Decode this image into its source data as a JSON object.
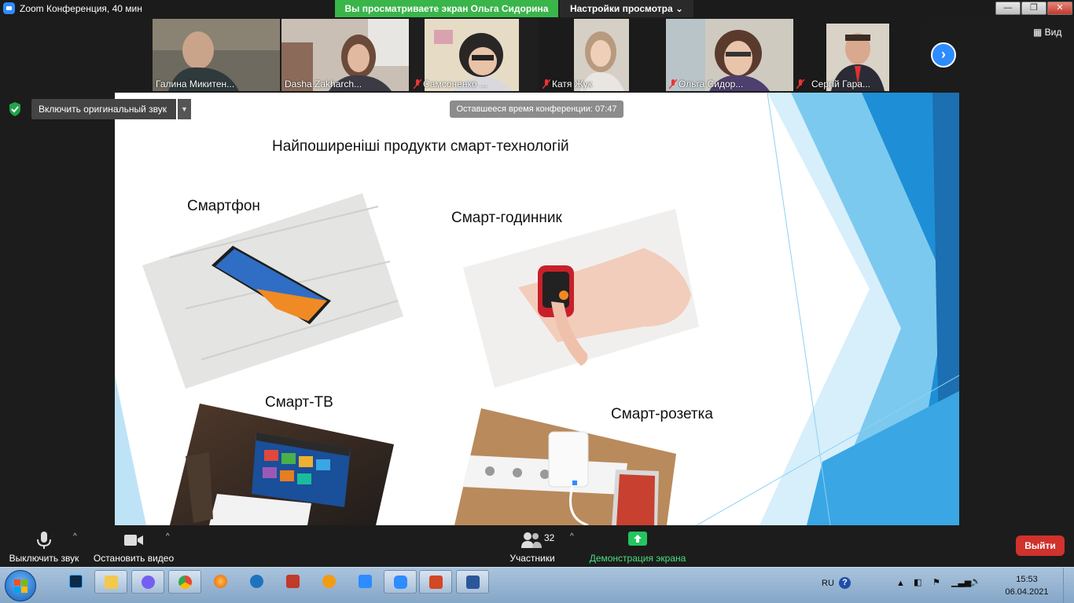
{
  "window": {
    "title": "Zoom Конференция, 40 мин",
    "share_banner": "Вы просматриваете экран Ольга Сидорина",
    "view_options": "Настройки просмотра",
    "view_label": "Вид"
  },
  "participants": [
    {
      "name": "Галина Микитен...",
      "muted": false
    },
    {
      "name": "Dasha Zakharch...",
      "muted": false,
      "active": true
    },
    {
      "name": "Самсоненко ...",
      "muted": true
    },
    {
      "name": "Катя Жук",
      "muted": true
    },
    {
      "name": "Ольга Сидор...",
      "muted": true
    },
    {
      "name": "Сергій Гара...",
      "muted": true
    }
  ],
  "overlay": {
    "original_audio": "Включить оригинальный звук",
    "time_left": "Оставшееся время конференции: 07:47"
  },
  "slide": {
    "title": "Найпоширеніші продукти смарт-технологій",
    "items": [
      "Смартфон",
      "Смарт-годинник",
      "Смарт-ТВ",
      "Смарт-розетка"
    ]
  },
  "toolbar": {
    "mute": "Выключить звук",
    "stop_video": "Остановить видео",
    "participants": "Участники",
    "participants_count": "32",
    "share": "Демонстрация экрана",
    "leave": "Выйти"
  },
  "taskbar": {
    "lang": "RU",
    "time": "15:53",
    "date": "06.04.2021"
  },
  "colors": {
    "zoom_blue": "#2d8cff",
    "share_green": "#39b54a",
    "leave_red": "#d0322d",
    "slide_accent": "#1e8fd6"
  }
}
